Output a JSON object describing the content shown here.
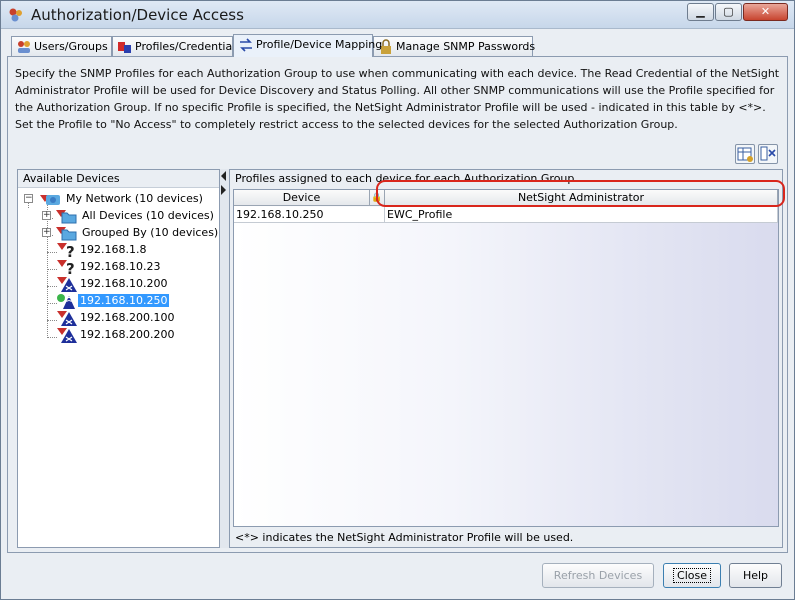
{
  "window": {
    "title": "Authorization/Device Access",
    "controls": {
      "minimize": "▁",
      "maximize": "▢",
      "close": "✕"
    }
  },
  "tabs": [
    {
      "label": "Users/Groups",
      "icon": "users-icon",
      "active": false
    },
    {
      "label": "Profiles/Credentials",
      "icon": "credentials-icon",
      "active": false
    },
    {
      "label": "Profile/Device Mapping",
      "icon": "mapping-icon",
      "active": true
    },
    {
      "label": "Manage SNMP Passwords",
      "icon": "lock-icon",
      "active": false
    }
  ],
  "description": "Specify the SNMP Profiles for each Authorization Group to use when communicating with each device.  The Read Credential of the NetSight Administrator Profile will be used for Device Discovery and Status Polling.  All other SNMP communications will use the Profile specified for the Authorization Group.  If no specific Profile is specified, the NetSight Administrator Profile will be used - indicated in this table by <*>.  Set the Profile to \"No Access\" to completely restrict access to the selected devices for the selected Authorization Group.",
  "toolbar": {
    "icons": [
      "table-settings-icon",
      "column-settings-icon"
    ]
  },
  "available_devices": {
    "header": "Available Devices",
    "tree": [
      {
        "label": "My Network (10 devices)",
        "level": 0,
        "expander": "−",
        "icon": "network-folder-icon"
      },
      {
        "label": "All Devices (10 devices)",
        "level": 1,
        "expander": "+",
        "icon": "folder-icon"
      },
      {
        "label": "Grouped By (10 devices)",
        "level": 1,
        "expander": "+",
        "icon": "folder-icon"
      },
      {
        "label": "192.168.1.8",
        "level": 1,
        "icon": "unknown-device-icon"
      },
      {
        "label": "192.168.10.23",
        "level": 1,
        "icon": "unknown-device-icon"
      },
      {
        "label": "192.168.10.200",
        "level": 1,
        "icon": "router-icon"
      },
      {
        "label": "192.168.10.250",
        "level": 1,
        "icon": "wireless-device-icon",
        "selected": true
      },
      {
        "label": "192.168.200.100",
        "level": 1,
        "icon": "router-icon"
      },
      {
        "label": "192.168.200.200",
        "level": 1,
        "icon": "router-icon"
      }
    ]
  },
  "profiles_panel": {
    "header": "Profiles assigned to each device for each Authorization Group",
    "columns": {
      "device": "Device",
      "lock": "🔒",
      "admin": "NetSight Administrator"
    },
    "rows": [
      {
        "device": "192.168.10.250",
        "admin": "EWC_Profile"
      }
    ],
    "footnote": "<*> indicates the NetSight Administrator Profile will be used."
  },
  "buttons": {
    "refresh": "Refresh Devices",
    "close": "Close",
    "help": "Help"
  },
  "colors": {
    "selection": "#3399ff",
    "highlight_oval": "#d9261c"
  }
}
